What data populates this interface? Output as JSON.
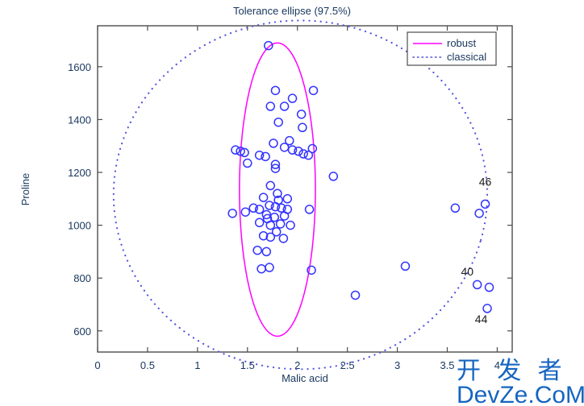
{
  "chart_data": {
    "type": "scatter",
    "title": "Tolerance ellipse (97.5%)",
    "xlabel": "Malic acid",
    "ylabel": "Proline",
    "xlim": [
      0,
      4.15
    ],
    "ylim": [
      520,
      1755
    ],
    "xticks": [
      0,
      0.5,
      1,
      1.5,
      2,
      2.5,
      3,
      3.5,
      4
    ],
    "xticklabels": [
      "0",
      "0.5",
      "1",
      "1.5",
      "2",
      "2.5",
      "3",
      "3.5",
      "4"
    ],
    "yticks": [
      600,
      800,
      1000,
      1200,
      1400,
      1600
    ],
    "yticklabels": [
      "600",
      "800",
      "1000",
      "1200",
      "1400",
      "1600"
    ],
    "grid": false,
    "marker": "open-circle",
    "marker_color": "#3333ff",
    "legend_position": "top-right",
    "legend": [
      {
        "label": "robust",
        "color": "#ff00ff",
        "style": "solid"
      },
      {
        "label": "classical",
        "color": "#5555dd",
        "style": "dotted"
      }
    ],
    "points": [
      {
        "x": 1.71,
        "y": 1680
      },
      {
        "x": 1.78,
        "y": 1510
      },
      {
        "x": 1.95,
        "y": 1480
      },
      {
        "x": 2.16,
        "y": 1510
      },
      {
        "x": 1.73,
        "y": 1450
      },
      {
        "x": 1.87,
        "y": 1450
      },
      {
        "x": 2.04,
        "y": 1420
      },
      {
        "x": 1.81,
        "y": 1390
      },
      {
        "x": 2.05,
        "y": 1370
      },
      {
        "x": 1.92,
        "y": 1320
      },
      {
        "x": 1.76,
        "y": 1310
      },
      {
        "x": 1.87,
        "y": 1295
      },
      {
        "x": 1.95,
        "y": 1285
      },
      {
        "x": 2.01,
        "y": 1280
      },
      {
        "x": 2.06,
        "y": 1270
      },
      {
        "x": 2.11,
        "y": 1265
      },
      {
        "x": 2.15,
        "y": 1290
      },
      {
        "x": 1.38,
        "y": 1285
      },
      {
        "x": 1.43,
        "y": 1280
      },
      {
        "x": 1.47,
        "y": 1275
      },
      {
        "x": 1.62,
        "y": 1265
      },
      {
        "x": 1.68,
        "y": 1260
      },
      {
        "x": 1.5,
        "y": 1235
      },
      {
        "x": 1.78,
        "y": 1230
      },
      {
        "x": 1.78,
        "y": 1215
      },
      {
        "x": 2.36,
        "y": 1185
      },
      {
        "x": 1.73,
        "y": 1150
      },
      {
        "x": 1.8,
        "y": 1120
      },
      {
        "x": 1.66,
        "y": 1105
      },
      {
        "x": 1.81,
        "y": 1095
      },
      {
        "x": 1.9,
        "y": 1100
      },
      {
        "x": 1.72,
        "y": 1075
      },
      {
        "x": 1.78,
        "y": 1070
      },
      {
        "x": 1.84,
        "y": 1065
      },
      {
        "x": 1.9,
        "y": 1060
      },
      {
        "x": 1.56,
        "y": 1065
      },
      {
        "x": 1.62,
        "y": 1060
      },
      {
        "x": 1.35,
        "y": 1045
      },
      {
        "x": 1.48,
        "y": 1050
      },
      {
        "x": 2.12,
        "y": 1060
      },
      {
        "x": 3.58,
        "y": 1065
      },
      {
        "x": 3.88,
        "y": 1080
      },
      {
        "x": 3.82,
        "y": 1045
      },
      {
        "x": 1.69,
        "y": 1040
      },
      {
        "x": 1.7,
        "y": 1025
      },
      {
        "x": 1.77,
        "y": 1030
      },
      {
        "x": 1.87,
        "y": 1035
      },
      {
        "x": 1.62,
        "y": 1010
      },
      {
        "x": 1.73,
        "y": 1000
      },
      {
        "x": 1.83,
        "y": 1005
      },
      {
        "x": 1.93,
        "y": 1000
      },
      {
        "x": 1.79,
        "y": 975
      },
      {
        "x": 1.66,
        "y": 960
      },
      {
        "x": 1.73,
        "y": 955
      },
      {
        "x": 1.86,
        "y": 950
      },
      {
        "x": 1.6,
        "y": 905
      },
      {
        "x": 1.69,
        "y": 900
      },
      {
        "x": 3.08,
        "y": 845
      },
      {
        "x": 1.64,
        "y": 835
      },
      {
        "x": 1.72,
        "y": 840
      },
      {
        "x": 2.14,
        "y": 830
      },
      {
        "x": 3.8,
        "y": 775
      },
      {
        "x": 3.92,
        "y": 765
      },
      {
        "x": 2.58,
        "y": 735
      },
      {
        "x": 3.9,
        "y": 685
      }
    ],
    "labeled_points": [
      {
        "label": "46",
        "x": 3.88,
        "y": 1150
      },
      {
        "label": "40",
        "x": 3.7,
        "y": 810
      },
      {
        "label": "44",
        "x": 3.84,
        "y": 630
      }
    ],
    "robust_ellipse": {
      "center_x": 1.8,
      "center_y": 1135,
      "semi_x": 0.38,
      "semi_y": 555,
      "rotation_deg": -3,
      "color": "#ff00ff"
    },
    "classical_ellipse": {
      "center_x": 2.03,
      "center_y": 1115,
      "semi_x": 1.87,
      "semi_y": 660,
      "rotation_deg": -15,
      "color": "#5555dd"
    }
  },
  "watermark": {
    "line1": "开 发 者",
    "line2": "DevZe.CoM",
    "color": "#1565c0"
  }
}
